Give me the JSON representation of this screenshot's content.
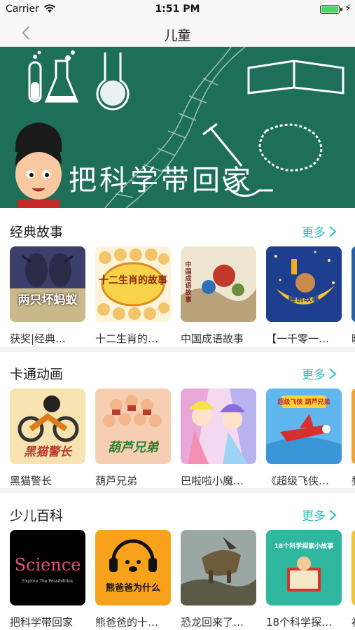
{
  "status_bar": {
    "carrier": "Carrier",
    "time": "1:51 PM",
    "charging_symbol": "⚡"
  },
  "nav": {
    "title": "儿童",
    "back_icon": "chevron-left-icon"
  },
  "banner": {
    "text": "把科学带回家",
    "pages": 3,
    "active_page": 1
  },
  "colors": {
    "accent": "#2cc0b6",
    "banner_bg": "#1d6f5a",
    "separator": "#f2f2f2"
  },
  "sections": [
    {
      "title": "经典故事",
      "more": "更多",
      "items": [
        {
          "caption": "获奖|经典…",
          "art_text": "两只坏蚂蚁"
        },
        {
          "caption": "十二生肖的…",
          "art_text": "十二生肖的故事"
        },
        {
          "caption": "中国成语故事",
          "art_text": "中国成语故事"
        },
        {
          "caption": "【一千零一…",
          "art_text": "睡前故事"
        },
        {
          "caption": "晚"
        }
      ]
    },
    {
      "title": "卡通动画",
      "more": "更多",
      "items": [
        {
          "caption": "黑猫警长",
          "art_text": "黑猫警长"
        },
        {
          "caption": "葫芦兄弟",
          "art_text": "葫芦兄弟"
        },
        {
          "caption": "巴啦啦小魔…"
        },
        {
          "caption": "《超级飞侠…",
          "art_text": "超级飞侠 葫芦兄弟"
        },
        {
          "caption": "婺"
        }
      ]
    },
    {
      "title": "少儿百科",
      "more": "更多",
      "items": [
        {
          "caption": "把科学带回家",
          "art_text": "Science",
          "art_subtext": "Explore The Possibilities"
        },
        {
          "caption": "熊爸爸的十…",
          "art_text": "熊爸爸为什么"
        },
        {
          "caption": "恐龙回来了…"
        },
        {
          "caption": "18个科学探…",
          "art_text": "18个科学探索小故事"
        },
        {
          "caption": "初"
        }
      ]
    }
  ]
}
